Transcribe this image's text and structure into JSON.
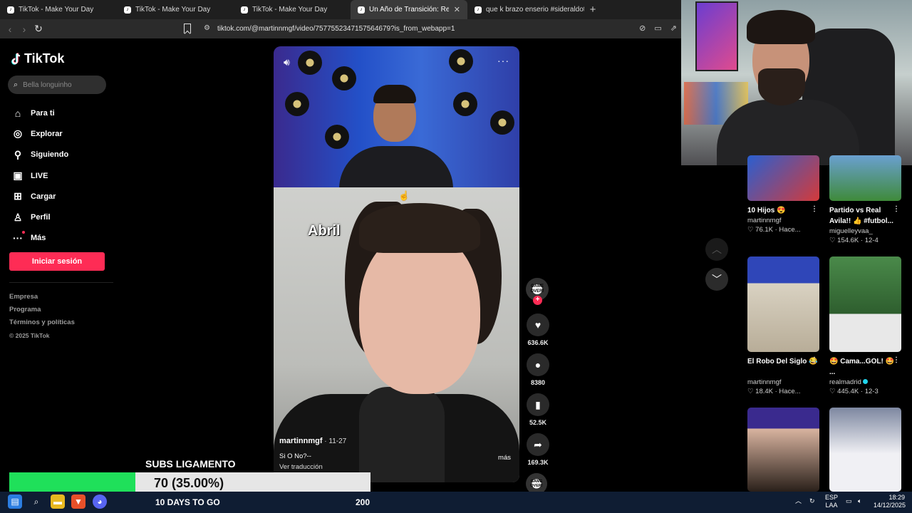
{
  "browser": {
    "tabs": [
      {
        "label": "TikTok - Make Your Day",
        "active": false
      },
      {
        "label": "TikTok - Make Your Day",
        "active": false
      },
      {
        "label": "TikTok - Make Your Day",
        "active": false
      },
      {
        "label": "Un Año de Transición: Reflexione",
        "active": true
      },
      {
        "label": "que k brazo enserio #sideraldota #g",
        "active": false
      }
    ],
    "new_tab": "+",
    "url": "tiktok.com/@martinnmgf/video/7577552347157564679?is_from_webapp=1"
  },
  "tiktok": {
    "logo": "TikTok",
    "search_placeholder": "Bella longuinho",
    "menu": [
      {
        "label": "Para ti",
        "icon": "home-icon"
      },
      {
        "label": "Explorar",
        "icon": "compass-icon"
      },
      {
        "label": "Siguiendo",
        "icon": "following-icon"
      },
      {
        "label": "LIVE",
        "icon": "live-icon"
      },
      {
        "label": "Cargar",
        "icon": "upload-icon"
      },
      {
        "label": "Perfil",
        "icon": "profile-icon"
      },
      {
        "label": "Más",
        "icon": "more-icon"
      }
    ],
    "login_label": "Iniciar sesión",
    "footer": [
      "Empresa",
      "Programa",
      "Términos y políticas"
    ],
    "copyright": "© 2025 TikTok"
  },
  "video": {
    "overlay_text": "Abril",
    "author": "martinnmgf",
    "date": "· 11-27",
    "description": "Si O No?--",
    "translate_label": "Ver traducción",
    "more_label": "más",
    "avatar_text": "GAME OVER!",
    "likes": "636.6K",
    "comments": "8380",
    "saves": "52.5K",
    "shares": "169.3K"
  },
  "recommendations": [
    {
      "title": "10 Hijos 😍",
      "author": "martinnmgf",
      "stats": "♡ 76.1K · Hace...",
      "thumb": "#3a3a7a"
    },
    {
      "title": "Partido vs Real Avila!! 👍 #futbol...",
      "author": "miguelleyvaa_",
      "stats": "♡ 154.6K · 12-4",
      "thumb": "#4a8a3a"
    },
    {
      "title": "El Robo Del Siglo 😂",
      "author": "martinnmgf",
      "stats": "♡ 18.4K · Hace...",
      "thumb": "#b8a890"
    },
    {
      "title": "🤩 Cama...GOL! 🤩 ...",
      "author": "realmadrid",
      "stats": "♡ 445.4K · 12-3",
      "thumb": "#3c7a3c"
    },
    {
      "title": "",
      "author": "",
      "stats": "",
      "thumb": "#6a4a8a"
    },
    {
      "title": "",
      "author": "",
      "stats": "",
      "thumb": "#8a94a8"
    }
  ],
  "overlay": {
    "subs_title": "SUBS LIGAMENTO",
    "progress_text": "70 (35.00%)",
    "progress_fraction": 0.35,
    "days_text": "10 DAYS TO GO",
    "goal": "200"
  },
  "taskbar": {
    "lang": "ESP",
    "lang2": "LAA",
    "time": "18:29",
    "date": "14/12/2025"
  },
  "colors": {
    "accent": "#fe2c55",
    "progress_green": "#1fe05a",
    "taskbar": "#0f1d33"
  }
}
